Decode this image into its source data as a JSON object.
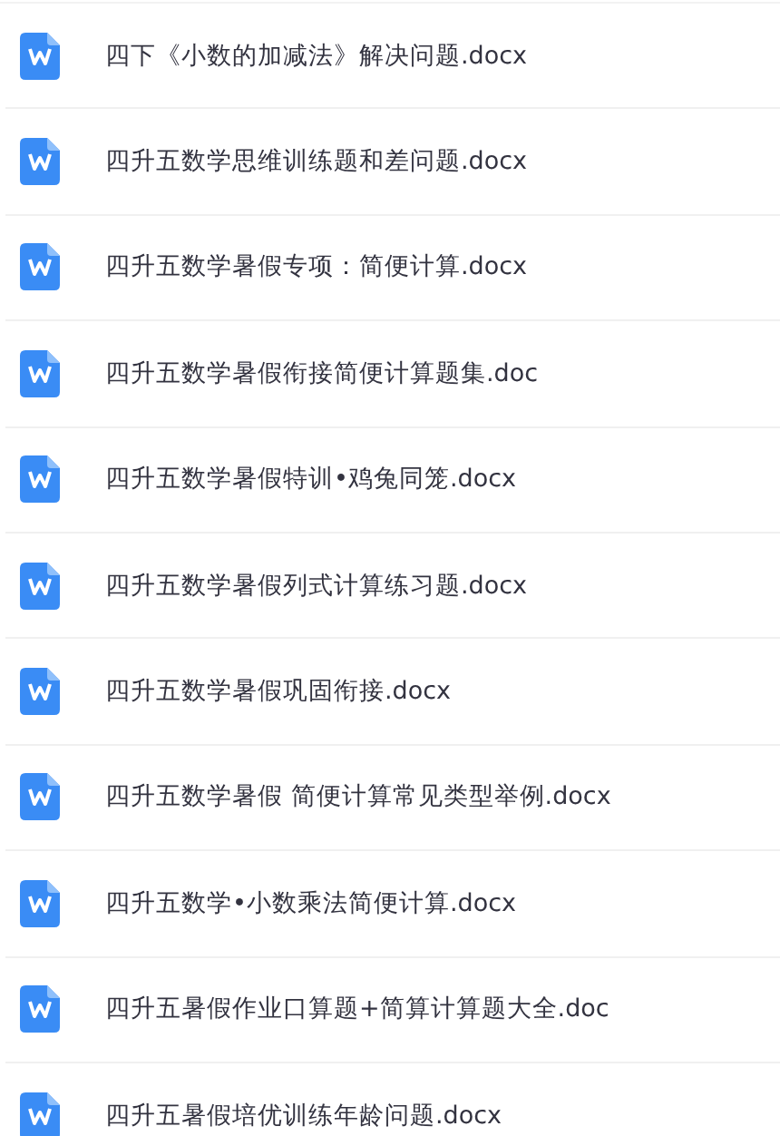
{
  "files": [
    {
      "name": "四下《小数的加减法》解决问题.docx"
    },
    {
      "name": "四升五数学思维训练题和差问题.docx"
    },
    {
      "name": "四升五数学暑假专项：简便计算.docx"
    },
    {
      "name": "四升五数学暑假衔接简便计算题集.doc"
    },
    {
      "name": "四升五数学暑假特训•鸡兔同笼.docx"
    },
    {
      "name": "四升五数学暑假列式计算练习题.docx"
    },
    {
      "name": "四升五数学暑假巩固衔接.docx"
    },
    {
      "name": "四升五数学暑假 简便计算常见类型举例.docx"
    },
    {
      "name": "四升五数学•小数乘法简便计算.docx"
    },
    {
      "name": "四升五暑假作业口算题+简算计算题大全.doc"
    },
    {
      "name": "四升五暑假培优训练年龄问题.docx"
    }
  ]
}
